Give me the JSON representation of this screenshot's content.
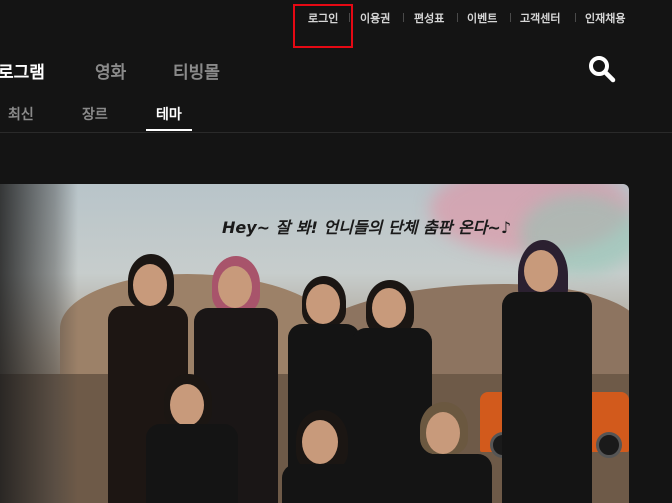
{
  "util_nav": [
    {
      "label": "로그인"
    },
    {
      "label": "이용권"
    },
    {
      "label": "편성표"
    },
    {
      "label": "이벤트"
    },
    {
      "label": "고객센터"
    },
    {
      "label": "인재채용"
    }
  ],
  "main_nav": [
    {
      "label": "로그램"
    },
    {
      "label": "영화"
    },
    {
      "label": "티빙몰"
    }
  ],
  "sub_nav": [
    {
      "label": "최신"
    },
    {
      "label": "장르"
    },
    {
      "label": "테마"
    }
  ],
  "banner": {
    "caption": "Hey~ 잘 봐! 언니들의 단체 춤판 온다~♪"
  },
  "colors": {
    "background": "#141414",
    "highlight": "#e50914",
    "active_text": "#ffffff",
    "inactive_text": "#8a8a8a"
  },
  "icons": {
    "search": "search-icon"
  }
}
